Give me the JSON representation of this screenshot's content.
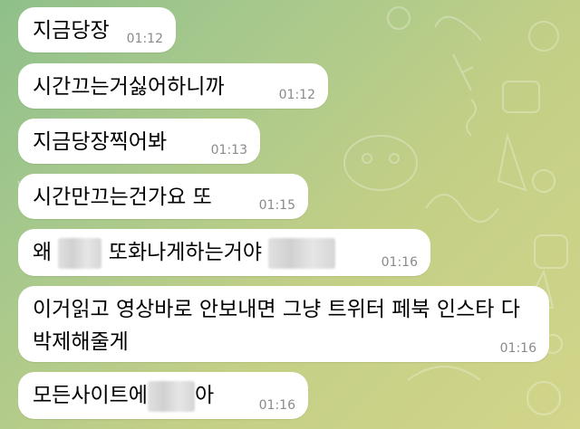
{
  "messages": [
    {
      "text": "지금당장",
      "time": "01:12"
    },
    {
      "text": "시간끄는거싫어하니까",
      "time": "01:12"
    },
    {
      "text": "지금당장찍어봐",
      "time": "01:13"
    },
    {
      "text": "시간만끄는건가요 또",
      "time": "01:15"
    },
    {
      "text_before": "왜",
      "text_middle": "또화나게하는거야",
      "time": "01:16"
    },
    {
      "text": "이거읽고 영상바로 안보내면 그냥 트위터 페북 인스타 다박제해줄게",
      "time": "01:16"
    },
    {
      "text_before": "모든사이트에",
      "text_after": "아",
      "time": "01:16"
    }
  ],
  "colors": {
    "bubble": "#ffffff",
    "time": "#8a8a8a",
    "wallpaper_start": "#8fc08a",
    "wallpaper_end": "#d2d58a"
  }
}
